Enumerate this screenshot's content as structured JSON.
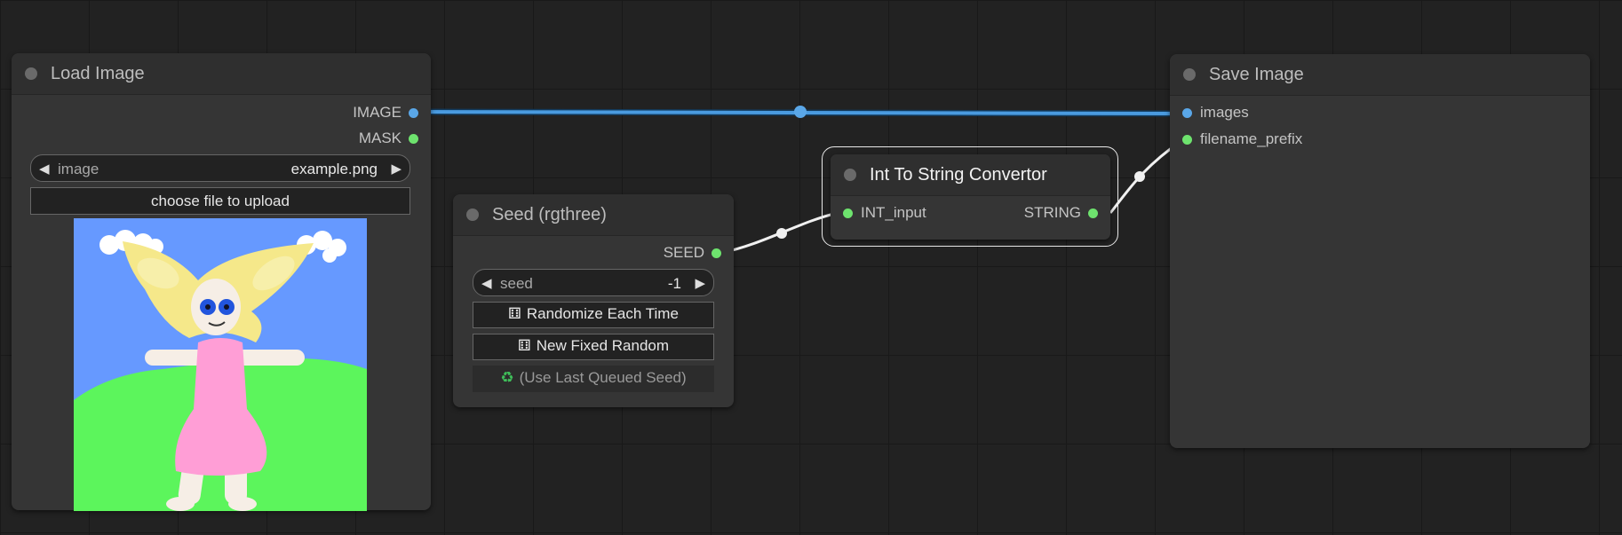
{
  "nodes": {
    "load_image": {
      "title": "Load Image",
      "outputs": [
        "IMAGE",
        "MASK"
      ],
      "image_widget": {
        "name": "image",
        "value": "example.png"
      },
      "upload_button": "choose file to upload"
    },
    "seed": {
      "title": "Seed (rgthree)",
      "outputs": [
        "SEED"
      ],
      "seed_widget": {
        "name": "seed",
        "value": "-1"
      },
      "buttons": {
        "randomize": "Randomize Each Time",
        "new_fixed": "New Fixed Random",
        "use_last": "(Use Last Queued Seed)"
      }
    },
    "int_to_string": {
      "title": "Int To String Convertor",
      "input": "INT_input",
      "output": "STRING"
    },
    "save_image": {
      "title": "Save Image",
      "inputs": [
        "images",
        "filename_prefix"
      ]
    }
  },
  "icons": {
    "dice": "dice-icon",
    "recycle": "recycle-icon",
    "arrow_left": "arrow-left-icon",
    "arrow_right": "arrow-right-icon"
  },
  "colors": {
    "canvas_bg": "#222222",
    "node_bg": "#353535",
    "node_title_bg": "#2f2f2f",
    "image_slot": "#5aa7e8",
    "int_slot": "#6ee36e",
    "image_link": "#4a9be0",
    "int_link": "#f0f0f0"
  }
}
